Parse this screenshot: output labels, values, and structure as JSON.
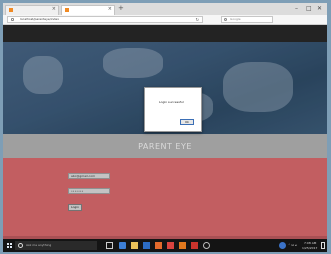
{
  "browser": {
    "tabs": [
      {
        "label": ""
      },
      {
        "label": ""
      }
    ],
    "url": "localhost/parenteye/index",
    "search_placeholder": "Google"
  },
  "site": {
    "brand": "PARENT EYE",
    "form": {
      "email_label": "",
      "email_value": "abc@gmail.com",
      "password_label": "",
      "password_value": "•••••••",
      "login_label": "Login"
    }
  },
  "dialog": {
    "message": "Login successful",
    "ok_label": "Ok"
  },
  "taskbar": {
    "search_placeholder": "Ask me anything",
    "time": "7:08 AM",
    "date": "1/25/2017"
  },
  "colors": {
    "hero": "#3f5f80",
    "band": "#bbbbbb",
    "form_bg": "#e46f73",
    "navstrip": "#2a2a2a",
    "taskbar": "#141414"
  }
}
